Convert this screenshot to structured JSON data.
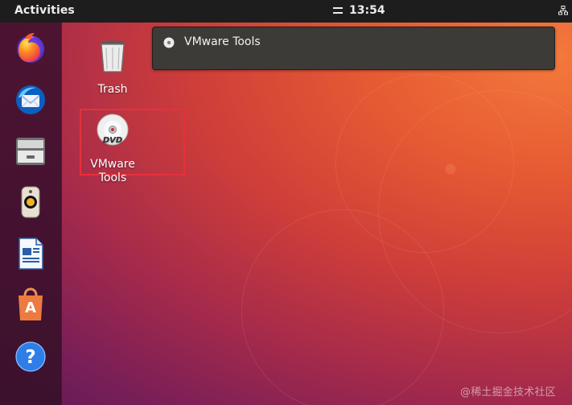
{
  "topbar": {
    "activities": "Activities",
    "time": "13:54"
  },
  "dock": {
    "items": [
      "firefox-icon",
      "thunderbird-icon",
      "files-icon",
      "rhythmbox-icon",
      "libreoffice-writer-icon",
      "software-center-icon",
      "help-icon"
    ]
  },
  "desktop": {
    "trash_label": "Trash",
    "vmware_label_line1": "VMware",
    "vmware_label_line2": "Tools"
  },
  "notification": {
    "label": "VMware Tools"
  },
  "watermark": "@稀土掘金技术社区",
  "colors": {
    "selection": "#e6313a",
    "panel": "#1d1d1d",
    "notification_bg": "#3c3b37"
  }
}
